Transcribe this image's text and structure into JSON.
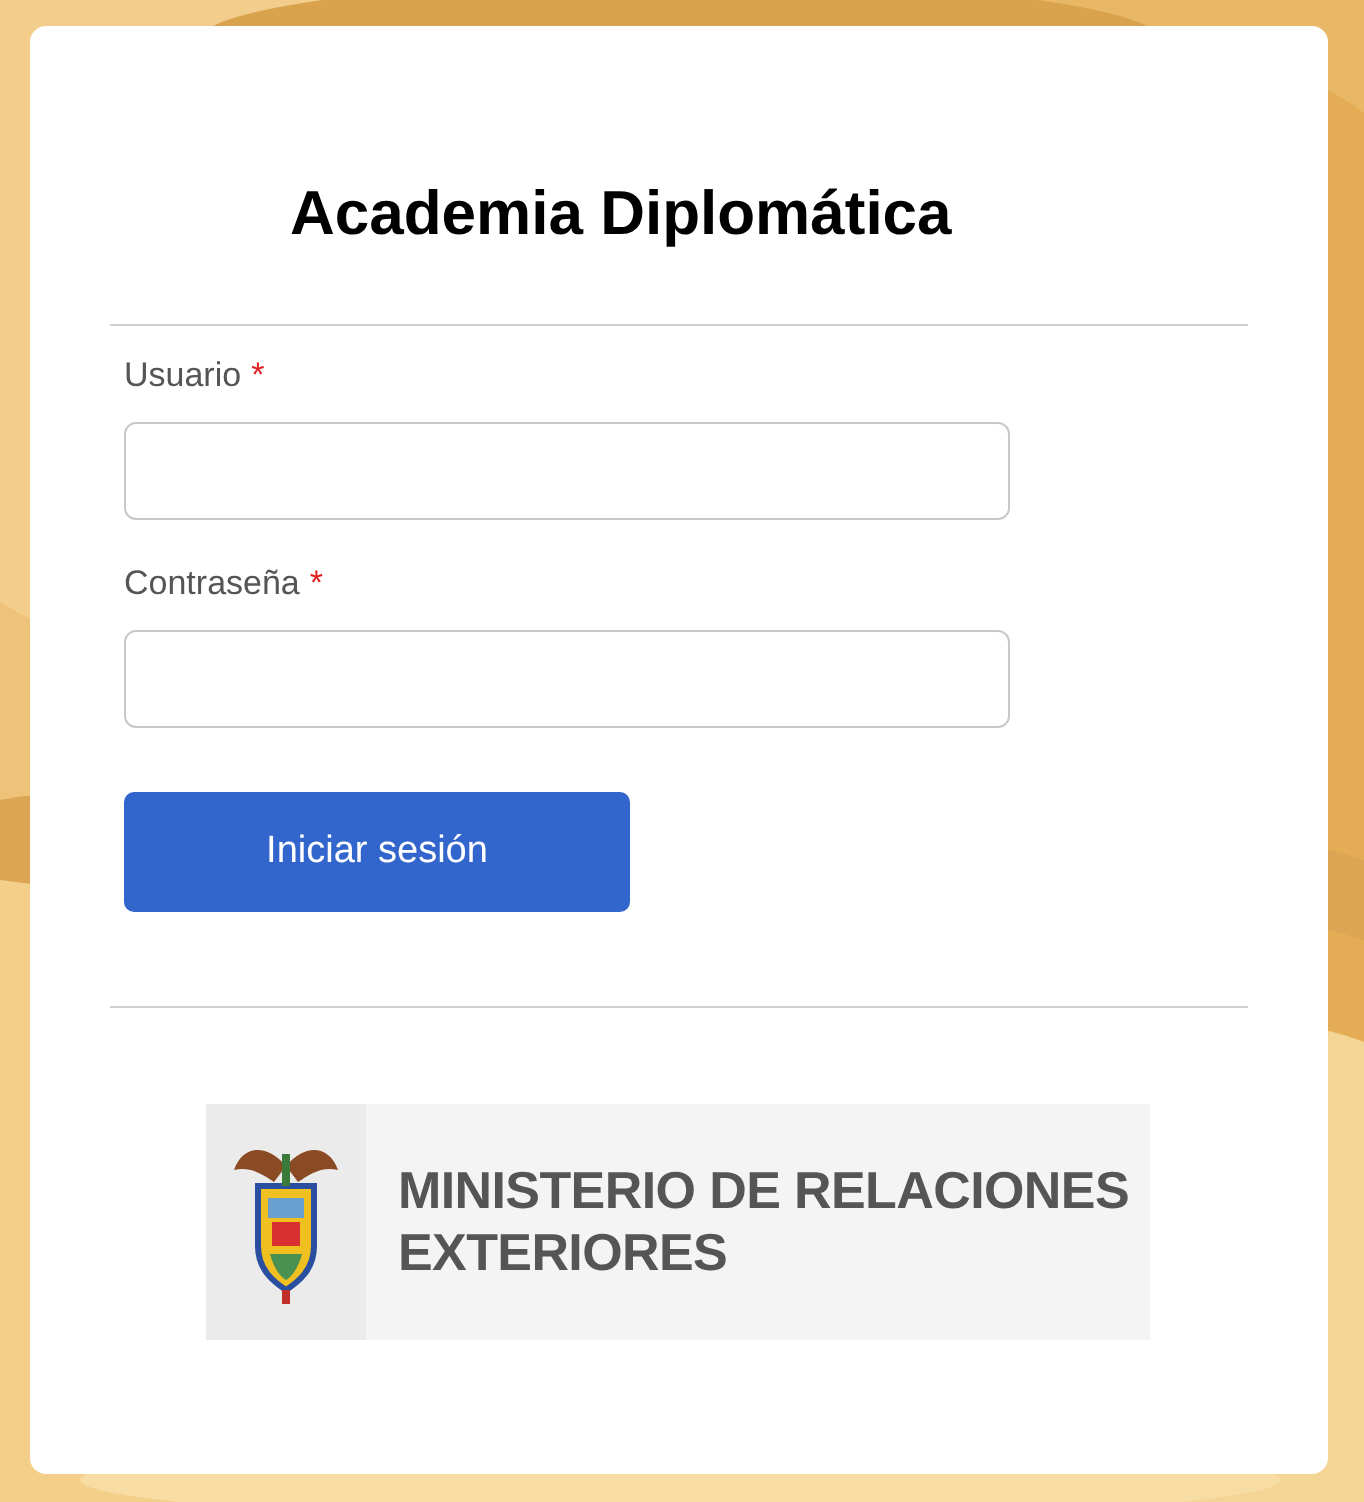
{
  "title": "Academia Diplomática",
  "fields": [
    {
      "label": "Usuario",
      "required_mark": "*"
    },
    {
      "label": "Contraseña",
      "required_mark": "*"
    }
  ],
  "submit": "Iniciar sesión",
  "logo": {
    "lines": [
      "MINISTERIO DE RELACIONES",
      "EXTERIORES"
    ]
  }
}
